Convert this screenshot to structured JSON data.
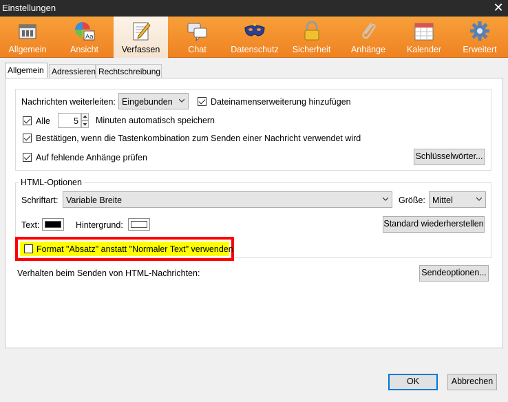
{
  "window": {
    "title": "Einstellungen",
    "close_glyph": "✕"
  },
  "toolbar": {
    "items": [
      {
        "label": "Allgemein",
        "icon": "general-icon"
      },
      {
        "label": "Ansicht",
        "icon": "display-icon"
      },
      {
        "label": "Verfassen",
        "icon": "compose-icon",
        "active": true
      },
      {
        "label": "Chat",
        "icon": "chat-icon"
      },
      {
        "label": "Datenschutz",
        "icon": "privacy-mask-icon"
      },
      {
        "label": "Sicherheit",
        "icon": "lock-icon"
      },
      {
        "label": "Anhänge",
        "icon": "paperclip-icon"
      },
      {
        "label": "Kalender",
        "icon": "calendar-icon"
      },
      {
        "label": "Erweitert",
        "icon": "gear-icon"
      }
    ]
  },
  "tabs": [
    "Allgemein",
    "Adressieren",
    "Rechtschreibung"
  ],
  "general": {
    "forward_label": "Nachrichten weiterleiten:",
    "forward_value": "Eingebunden",
    "ext_label": "Dateinamenserweiterung hinzufügen",
    "autosave_label": "Alle",
    "autosave_value": "5",
    "autosave_suffix": "Minuten automatisch speichern",
    "confirm_label": "Bestätigen, wenn die Tastenkombination zum Senden einer Nachricht verwendet wird",
    "attach_label": "Auf fehlende Anhänge prüfen",
    "keywords_button": "Schlüsselwörter..."
  },
  "html_options": {
    "legend": "HTML-Optionen",
    "font_label": "Schriftart:",
    "font_value": "Variable Breite",
    "size_label": "Größe:",
    "size_value": "Mittel",
    "text_label": "Text:",
    "bg_label": "Hintergrund:",
    "text_color": "#000000",
    "bg_color": "#ffffff",
    "restore_button": "Standard wiederherstellen",
    "paragraph_label": "Format \"Absatz\" anstatt \"Normaler Text\" verwenden"
  },
  "send": {
    "label": "Verhalten beim Senden von HTML-Nachrichten:",
    "button": "Sendeoptionen..."
  },
  "footer": {
    "ok": "OK",
    "cancel": "Abbrechen"
  },
  "colors": {
    "toolbar_orange": "#f39230",
    "highlight_yellow": "#ffff00",
    "highlight_border": "#ff0000",
    "default_button": "#0078d7"
  }
}
